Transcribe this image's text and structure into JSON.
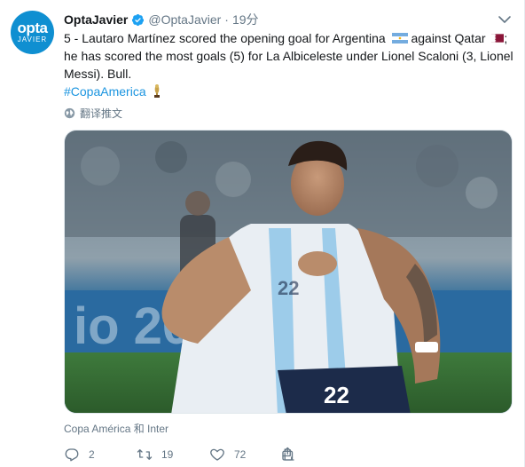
{
  "author": {
    "avatar_brand": "opta",
    "avatar_sub": "JAVIER",
    "name": "OptaJavier",
    "handle": "@OptaJavier",
    "separator": "·",
    "time": "19分"
  },
  "tweet": {
    "text_part1": "5 - Lautaro Martínez scored the opening goal for Argentina",
    "text_part2": " against Qatar",
    "text_part3": "; he has scored the most goals (5) for La Albiceleste under Lionel Scaloni (3, Lionel Messi). Bull.",
    "hashtag": "#CopaAmerica",
    "translate_label": "翻译推文"
  },
  "media": {
    "caption": "Copa América 和 Inter",
    "jersey_number": "22"
  },
  "actions": {
    "replies": "2",
    "retweets": "19",
    "likes": "72"
  },
  "colors": {
    "link": "#1b95e0",
    "secondary_text": "#657786",
    "verified": "#1da1f2",
    "avatar_bg": "#0f8fd1"
  },
  "icons": [
    "verified-badge-icon",
    "chevron-down-icon",
    "argentina-flag-icon",
    "qatar-flag-icon",
    "trophy-icon",
    "globe-icon",
    "reply-icon",
    "retweet-icon",
    "heart-icon",
    "share-icon"
  ]
}
